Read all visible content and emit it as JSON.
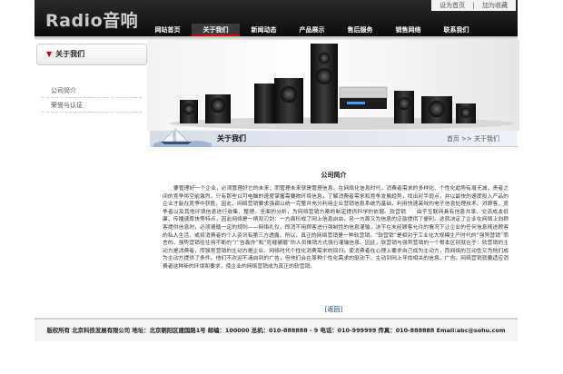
{
  "header": {
    "logo_latin": "Radio",
    "logo_cn": "音响",
    "top_links": [
      "设为首页",
      "|",
      "加为收藏"
    ]
  },
  "nav": {
    "items": [
      "网站首页",
      "关于我们",
      "新闻动态",
      "产品展示",
      "售后服务",
      "销售网络",
      "联系我们"
    ],
    "active_index": 1
  },
  "sidebar": {
    "title": "关于我们",
    "items": [
      "公司简介",
      "荣誉与认证"
    ]
  },
  "content": {
    "section_title": "关于我们",
    "breadcrumb": "首页 >> 关于我们",
    "article_title": "公司简介",
    "article_body": "要管理好一个企业，必须管理好它的未来；而管理未来就是管理信息。在网络化信息时代，消费者需求的多样化、个性化趋势有增无减，贵者之间的竞争将空前激烈，只有那些以可电脑的速度掌握需要物环境信息，了解消费者需求和竞争发展趋势，找出对手弱点，并以最快的速度投入产品的企业才能在竞争中获胜。因此，网络营销要求强调以统一完整并充分利用企业营销信息系统为基础，利用快速高效的电子信息处理技术、对顾客、竞争者以及其他环境信息进行收集、整理。全面的分析，为网络营销方案的制定提供科学的依据。软营销　　由于互联网具有信息共享、交流成本低廉、传播速度快等特点，因此网络是一柄双刃剑：一方面形成了网上信息自由，另一方面又为信息的泛滥提供了便利。这就决定了企业在网络上向顾客提供信息时，必须遵循一定的规则——网络礼仪，即消不用顾客进行强制性的信息灌输，决不在未经顾客允许的情况下让企业的任何信息闯进顾客的私人生活，或将消费者的个人资讯有第三方透露。所以，真正的网络营销是一种软营销。“软营销”是相对于工业化大规模生产时代的“强势营销”而言的。强势营销往往用不断的“广告轰炸”和“死缠硬磨”的人员推销方式强行灌输信息。因此，软营销与强势营销的一个根本区别就在于：软营销的主动方是消费者，而强势营销的主动方是企业。网络时代个性化消费需求的回归，使消费者在心理上要求自己成为主动方，而网络的互动性又为他们成为主动方提供了条件。他们不欢迎不请自到的广告，但他们会在某种个性化需求的驱动下，主动到网上寻找相关的信息、广告。网络营销就要适应消费者这种新的环境和要求，使企业的网络营销成为真正的软营销。",
    "back_label": "[返回]"
  },
  "footer": {
    "text": "版权所有 北京科技发展有限公司 地址：北京朝阳区建国路1号 邮编：100000 总机：010-888888 - 9 电话：010-999999 传真：010-888888 Email:abc@sohu.com"
  },
  "colors": {
    "header_bg": "#111111",
    "accent_red": "#cc0000",
    "breadcrumb_bg": "#d6dce8",
    "link_blue": "#1a3fa0"
  }
}
